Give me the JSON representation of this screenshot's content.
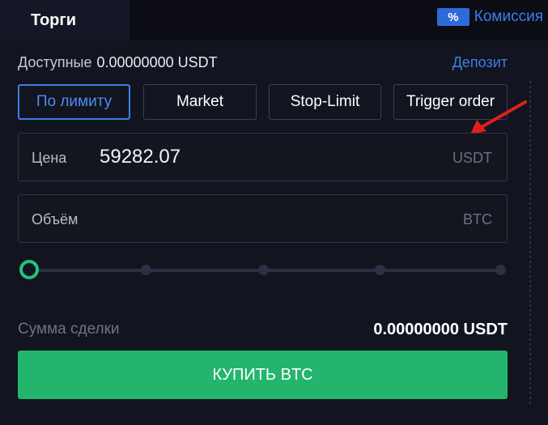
{
  "header": {
    "tab_label": "Торги",
    "commission_icon": "%",
    "commission_label": "Комиссия"
  },
  "balance": {
    "label": "Доступные",
    "amount": "0.00000000 USDT",
    "deposit_link": "Депозит"
  },
  "order_types": [
    {
      "label": "По лимиту",
      "active": true
    },
    {
      "label": "Market",
      "active": false
    },
    {
      "label": "Stop-Limit",
      "active": false
    },
    {
      "label": "Trigger order",
      "active": false
    }
  ],
  "price_field": {
    "label": "Цена",
    "value": "59282.07",
    "unit": "USDT"
  },
  "volume_field": {
    "label": "Объём",
    "value": "",
    "unit": "BTC"
  },
  "slider": {
    "value_percent": 0,
    "steps": [
      0,
      25,
      50,
      75,
      100
    ]
  },
  "total": {
    "label": "Сумма сделки",
    "value": "0.00000000 USDT"
  },
  "buy_button": {
    "label": "КУПИТЬ BTC"
  },
  "colors": {
    "accent_blue": "#3f7ee8",
    "buy_green": "#23b56d",
    "slider_green": "#1fc47a",
    "annotation_red": "#e01e1e",
    "background": "#12141f"
  }
}
